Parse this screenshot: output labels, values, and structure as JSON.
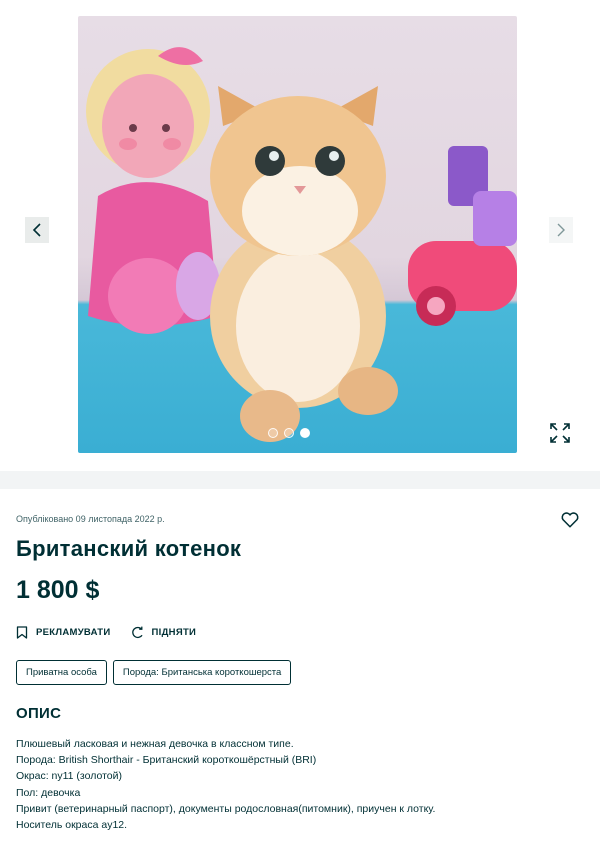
{
  "gallery": {
    "image_alt": "photo-kitten",
    "prev_icon": "chevron-left-icon",
    "next_icon": "chevron-right-icon",
    "expand_icon": "expand-icon",
    "slide_count": 3,
    "active_slide": 3
  },
  "listing": {
    "published": "Опубліковано 09 листопада 2022 р.",
    "title": "Британский котенок",
    "price": "1 800 $",
    "actions": {
      "promote": "РЕКЛАМУВАТИ",
      "raise": "ПІДНЯТИ"
    },
    "tags": [
      "Приватна особа",
      "Порода: Британська короткошерста"
    ],
    "description_title": "ОПИС",
    "description_lines": [
      "Плюшевый ласковая и нежная девочка в классном типе.",
      "Порода: British Shorthair - Британский короткошёрстный (BRI)",
      "Окрас: ny11 (золотой)",
      "Пол: девочка",
      "Привит (ветеринарный паспорт), документы родословная(питомник), приучен к лотку.",
      "Носитель окраса ay12."
    ]
  },
  "colors": {
    "text": "#002f34",
    "page_bg": "#f2f4f5",
    "card_bg": "#ffffff"
  }
}
